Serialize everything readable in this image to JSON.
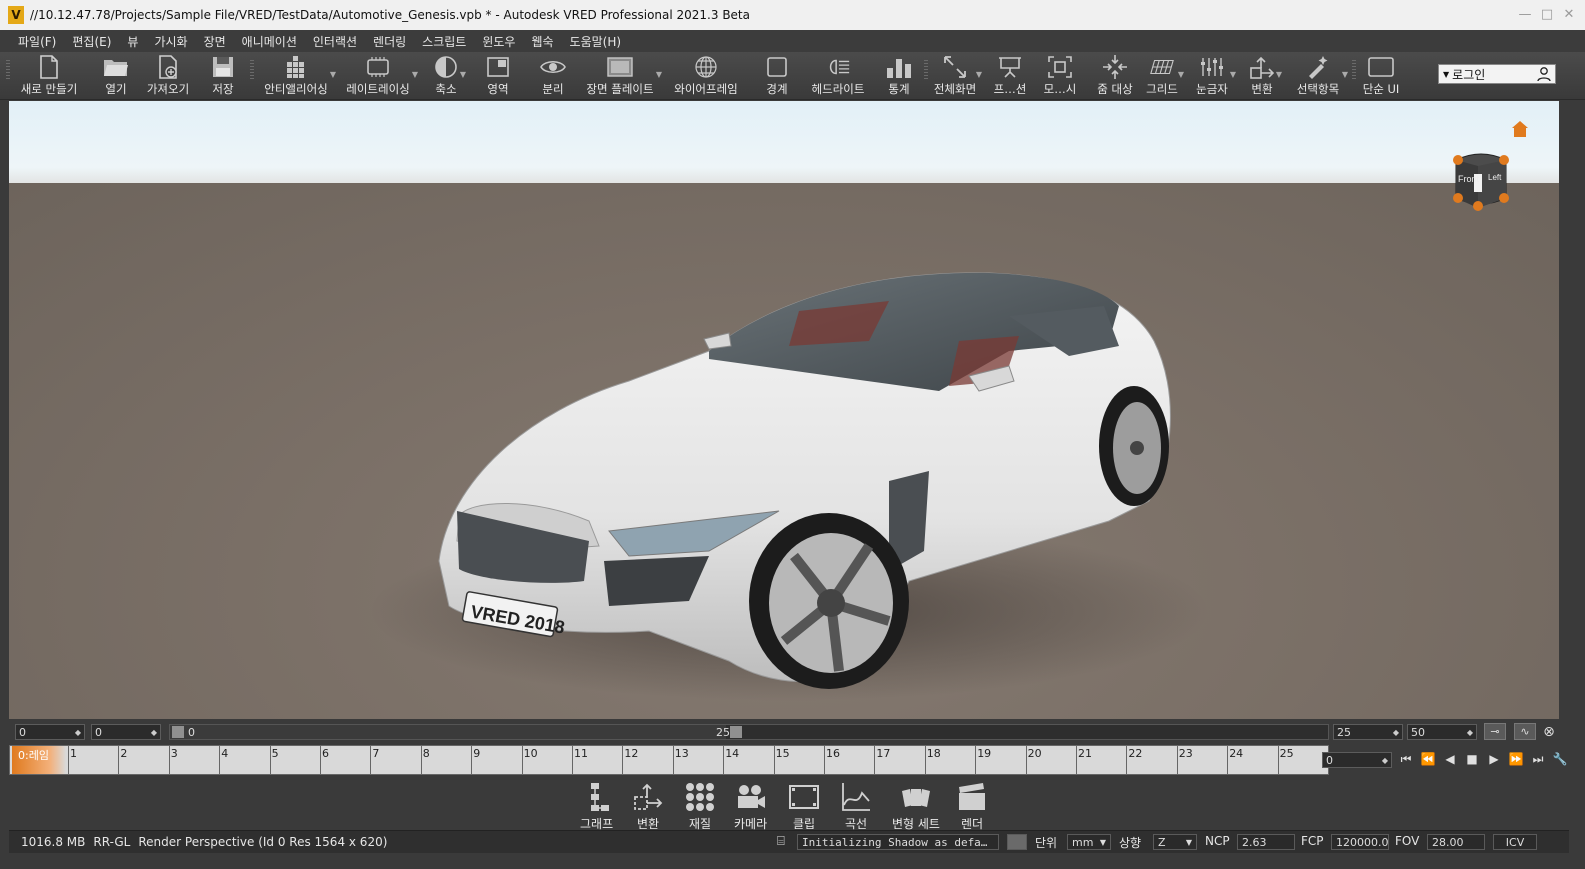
{
  "window": {
    "title": "//10.12.47.78/Projects/Sample File/VRED/TestData/Automotive_Genesis.vpb * - Autodesk VRED Professional 2021.3 Beta",
    "logo_letter": "V",
    "controls": [
      "—",
      "□",
      "✕"
    ]
  },
  "menu": [
    "파일(F)",
    "편집(E)",
    "뷰",
    "가시화",
    "장면",
    "애니메이션",
    "인터랙션",
    "렌더링",
    "스크립트",
    "윈도우",
    "웹숙",
    "도움말(H)"
  ],
  "toolbar": {
    "new": "새로 만들기",
    "open": "열기",
    "import": "가져오기",
    "save": "저장",
    "antialiasing": "안티앨리어싱",
    "raytracing": "레이트레이싱",
    "cpu_badge": "CPU",
    "reduce": "축소",
    "region": "영역",
    "separate": "분리",
    "scene_plate": "장면 플레이트",
    "wireframe": "와이어프레임",
    "bounds": "경계",
    "headlight": "헤드라이트",
    "stats": "통계",
    "fullscreen": "전체화면",
    "presentation": "프…션",
    "show_all": "모…시",
    "zoom_target": "줌 대상",
    "grid": "그리드",
    "ruler": "눈금자",
    "transform": "변환",
    "selection": "선택항목",
    "simple_ui": "단순 UI",
    "ui_badge": "UI",
    "login": "로그인"
  },
  "viewport": {
    "license_plate": "VRED 2018",
    "nav_cube": {
      "front": "Front",
      "left": "Left"
    }
  },
  "timebar": {
    "start_value": "0",
    "end_value": "0",
    "slider_min": "0",
    "slider_value": "25",
    "fps_value": "25",
    "range_value": "50"
  },
  "timeline": {
    "current_label": "0:레임",
    "ticks": [
      "1",
      "2",
      "3",
      "4",
      "5",
      "6",
      "7",
      "8",
      "9",
      "10",
      "11",
      "12",
      "13",
      "14",
      "15",
      "16",
      "17",
      "18",
      "19",
      "20",
      "21",
      "22",
      "23",
      "24",
      "25"
    ],
    "frame_value": "0"
  },
  "dock": [
    "그래프",
    "변환",
    "재질",
    "카메라",
    "클립",
    "곡선",
    "변형 세트",
    "렌더"
  ],
  "status": {
    "memory": "1016.8 MB",
    "renderer": "RR-GL",
    "render_info": "Render Perspective (Id 0 Res 1564 x 620)",
    "message": "Initializing Shadow as defa…",
    "unit_label": "단위",
    "unit_value": "mm",
    "up_label": "상향",
    "up_value": "Z",
    "ncp_label": "NCP",
    "ncp_value": "2.63",
    "fcp_label": "FCP",
    "fcp_value": "120000.00",
    "fov_label": "FOV",
    "fov_value": "28.00",
    "icv_label": "ICV"
  },
  "colors": {
    "accent": "#e07a1e",
    "logo": "#e4a817",
    "background": "#3a3a3a"
  }
}
